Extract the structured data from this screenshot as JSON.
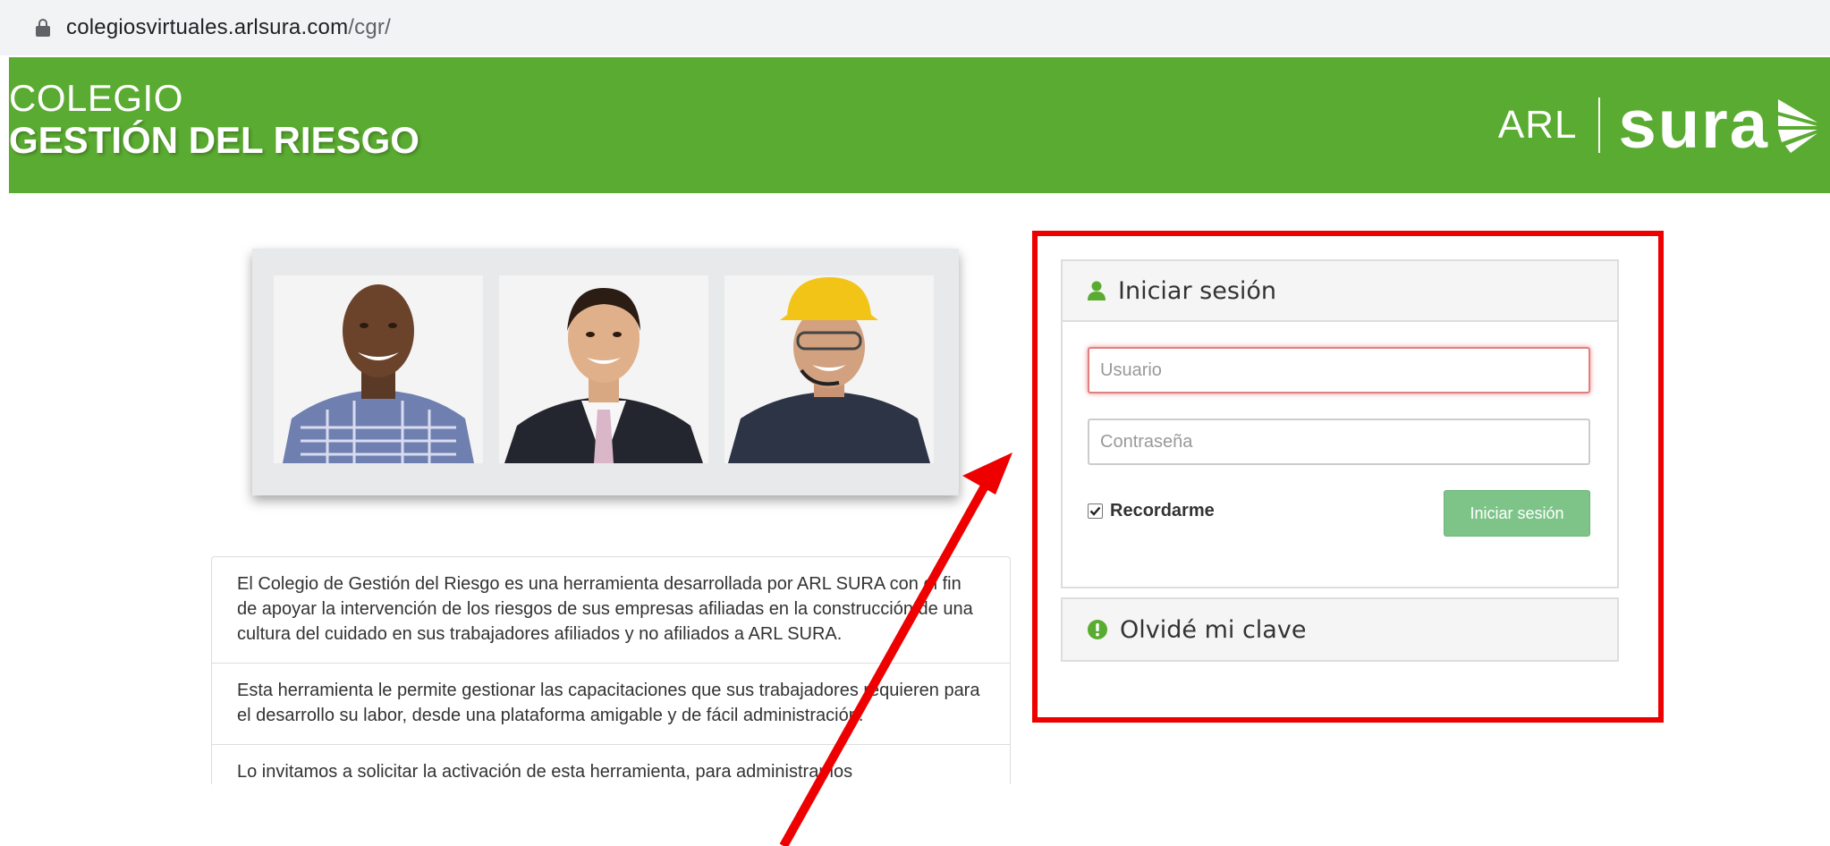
{
  "browser": {
    "url_host": "colegiosvirtuales.arlsura.com",
    "url_path": "/cgr/",
    "lock_icon": "lock-icon"
  },
  "header": {
    "line1": "COLEGIO",
    "line2": "GESTIÓN DEL RIESGO",
    "logo_arl": "ARL",
    "logo_sura": "sura",
    "background": "#5aab31"
  },
  "info": {
    "items": [
      "El Colegio de Gestión del Riesgo es una herramienta desarrollada por ARL SURA con el fin de apoyar la intervención de los riesgos de sus empresas afiliadas en la construcción de una cultura del cuidado en sus trabajadores afiliados y no afiliados a ARL SURA.",
      "Esta herramienta le permite gestionar las capacitaciones que sus trabajadores requieren para el desarrollo su labor, desde una plataforma amigable y de fácil administración.",
      "Lo invitamos a solicitar la activación de esta herramienta, para administrar los"
    ]
  },
  "login": {
    "title": "Iniciar sesión",
    "user_placeholder": "Usuario",
    "password_placeholder": "Contraseña",
    "remember_label": "Recordarme",
    "remember_checked": true,
    "submit_label": "Iniciar sesión",
    "button_color": "#7ec489"
  },
  "forgot": {
    "title": "Olvidé mi clave"
  },
  "annotation": {
    "highlight_color": "#ee0000"
  }
}
